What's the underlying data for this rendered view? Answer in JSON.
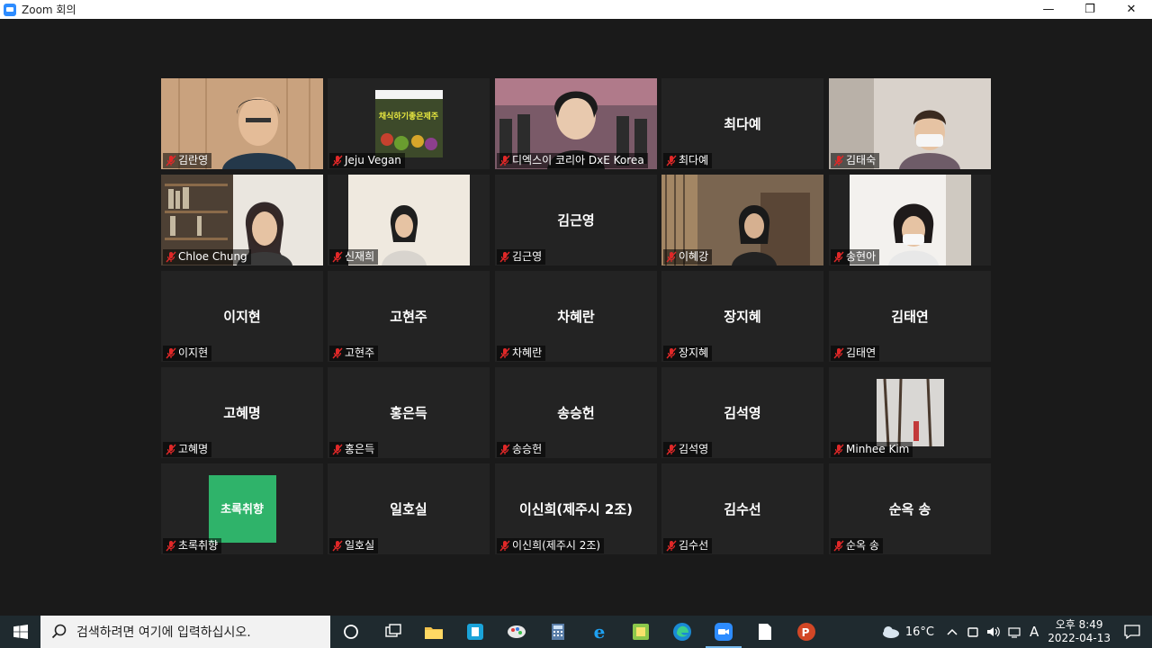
{
  "window": {
    "title": "Zoom 회의",
    "minimize": "—",
    "restore": "❐",
    "close": "✕"
  },
  "participants": [
    {
      "display": "",
      "label": "김란영",
      "video": true
    },
    {
      "display": "",
      "label": "Jeju Vegan",
      "video": true,
      "image_text": "채식하기좋은제주"
    },
    {
      "display": "",
      "label": "디엑스이 코리아 DxE Korea",
      "video": true,
      "active": true
    },
    {
      "display": "최다예",
      "label": "최다예",
      "video": false
    },
    {
      "display": "",
      "label": "김태숙",
      "video": true
    },
    {
      "display": "",
      "label": "Chloe Chung",
      "video": true
    },
    {
      "display": "",
      "label": "신재희",
      "video": true
    },
    {
      "display": "김근영",
      "label": "김근영",
      "video": false
    },
    {
      "display": "",
      "label": "이혜강",
      "video": true
    },
    {
      "display": "",
      "label": "송현아",
      "video": true
    },
    {
      "display": "이지현",
      "label": "이지현",
      "video": false
    },
    {
      "display": "고현주",
      "label": "고현주",
      "video": false
    },
    {
      "display": "차혜란",
      "label": "차혜란",
      "video": false
    },
    {
      "display": "장지혜",
      "label": "장지혜",
      "video": false
    },
    {
      "display": "김태연",
      "label": "김태연",
      "video": false
    },
    {
      "display": "고혜명",
      "label": "고혜명",
      "video": false
    },
    {
      "display": "홍은득",
      "label": "홍은득",
      "video": false
    },
    {
      "display": "송승헌",
      "label": "송승헌",
      "video": false
    },
    {
      "display": "김석영",
      "label": "김석영",
      "video": false
    },
    {
      "display": "",
      "label": "Minhee Kim",
      "video": true
    },
    {
      "display": "",
      "label": "초록취향",
      "video": true,
      "image_text": "초록취향"
    },
    {
      "display": "일호실",
      "label": "일호실",
      "video": false
    },
    {
      "display": "이신희(제주시 2조)",
      "label": "이신희(제주시 2조)",
      "video": false
    },
    {
      "display": "김수선",
      "label": "김수선",
      "video": false
    },
    {
      "display": "순옥 송",
      "label": "순옥 송",
      "video": false
    }
  ],
  "taskbar": {
    "search_placeholder": "검색하려면 여기에 입력하십시오.",
    "weather": "16°C",
    "ime": "A",
    "time": "오후 8:49",
    "date": "2022-04-13"
  },
  "colors": {
    "accent": "#2d8cff",
    "active_border": "#e6e26a",
    "muted_mic": "#e02828",
    "tile_bg": "#232323",
    "stage_bg": "#1a1a1a"
  }
}
